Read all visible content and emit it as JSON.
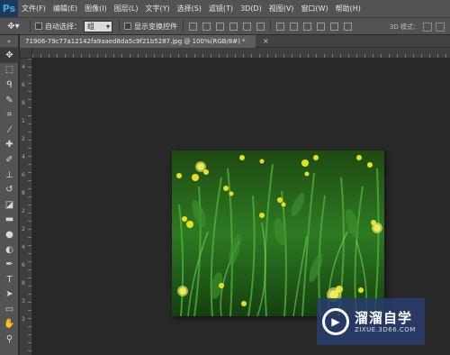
{
  "app": {
    "logo": "Ps"
  },
  "menu": [
    "文件(F)",
    "编辑(E)",
    "图像(I)",
    "图层(L)",
    "文字(Y)",
    "选择(S)",
    "滤镜(T)",
    "3D(D)",
    "视图(V)",
    "窗口(W)",
    "帮助(H)"
  ],
  "options": {
    "auto_select_label": "自动选择：",
    "auto_select_value": "组",
    "show_transform_label": "显示变换控件",
    "mode_3d_label": "3D 模式："
  },
  "document": {
    "tab_title": "71906-79c77a12142fa9aaed8da5c9f21b5287.jpg @ 100%(RGB/8#) *",
    "close": "×"
  },
  "rulers": {
    "left_labels": [
      "4",
      "6",
      "8",
      "1",
      "2",
      "4",
      "6",
      "8",
      "2",
      "2",
      "4",
      "6",
      "8",
      "3",
      "3"
    ]
  },
  "watermark": {
    "title": "溜溜自学",
    "url": "ZIXUE.3D66.COM"
  },
  "colors": {
    "panel": "#535353",
    "canvas_bg": "#282828",
    "watermark_bg": "#283c6e"
  }
}
